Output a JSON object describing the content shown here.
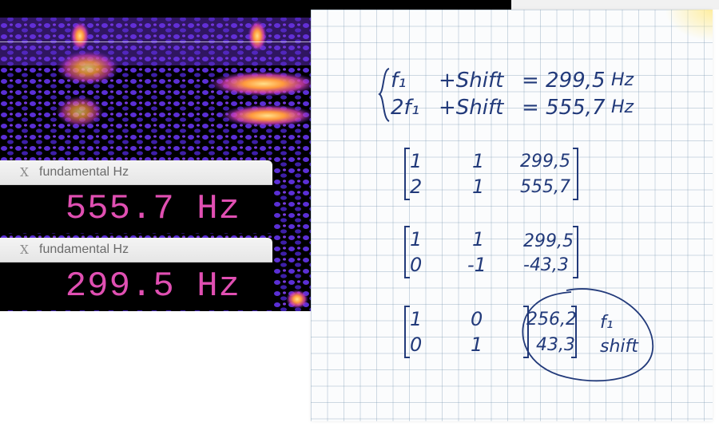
{
  "readouts": [
    {
      "title": "fundamental Hz",
      "value": "555.7 Hz",
      "close_icon": "close-x-icon"
    },
    {
      "title": "fundamental Hz",
      "value": "299.5 Hz",
      "close_icon": "close-x-icon"
    }
  ],
  "notes": {
    "system": {
      "line1": {
        "term1": "f₁",
        "term2": "+Shift",
        "eq": "= 299,5",
        "unit": "Hz"
      },
      "line2": {
        "term1": "2f₁",
        "term2": "+Shift",
        "eq": "= 555,7",
        "unit": "Hz"
      }
    },
    "matrix1": {
      "rows": [
        [
          "1",
          "1",
          "299,5"
        ],
        [
          "2",
          "1",
          "555,7"
        ]
      ]
    },
    "matrix2": {
      "rows": [
        [
          "1",
          "1",
          "299,5"
        ],
        [
          "0",
          "-1",
          "-43,3"
        ]
      ]
    },
    "matrix3": {
      "rows": [
        [
          "1",
          "0",
          "256,2"
        ],
        [
          "0",
          "1",
          "43,3"
        ]
      ]
    },
    "labels": {
      "f1": "f₁",
      "shift": "shift"
    }
  },
  "colors": {
    "readout_text": "#e04fb2",
    "spectrogram_bg": "#000000",
    "ink": "#223a7a"
  }
}
